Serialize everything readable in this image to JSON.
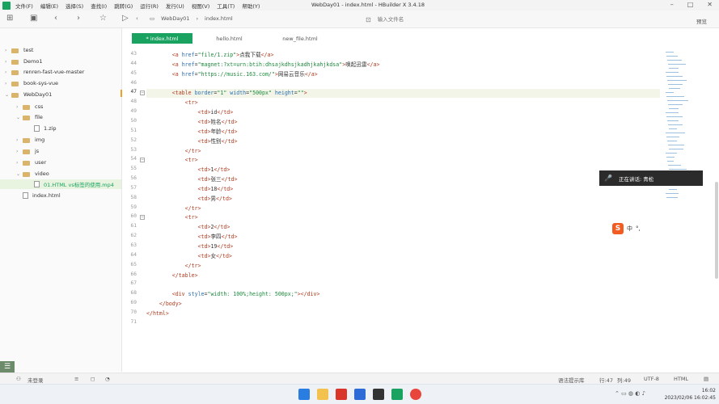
{
  "window": {
    "title": "WebDay01 - index.html - HBuilder X 3.4.18"
  },
  "menu": [
    "文件(F)",
    "编辑(E)",
    "选择(S)",
    "查找(I)",
    "跳转(G)",
    "运行(R)",
    "发行(U)",
    "视图(V)",
    "工具(T)",
    "帮助(Y)"
  ],
  "breadcrumb": [
    "WebDay01",
    "index.html"
  ],
  "search": {
    "placeholder": "输入文件名"
  },
  "preview_label": "预览",
  "sidebar": {
    "items": [
      {
        "label": "test",
        "type": "folder",
        "indent": 0,
        "expanded": false
      },
      {
        "label": "Demo1",
        "type": "folder",
        "indent": 0,
        "expanded": false
      },
      {
        "label": "renren-fast-vue-master",
        "type": "folder",
        "indent": 0,
        "expanded": false
      },
      {
        "label": "book-sys-vue",
        "type": "folder",
        "indent": 0,
        "expanded": false
      },
      {
        "label": "WebDay01",
        "type": "folder",
        "indent": 0,
        "expanded": true
      },
      {
        "label": "css",
        "type": "folder",
        "indent": 1,
        "expanded": false
      },
      {
        "label": "file",
        "type": "folder",
        "indent": 1,
        "expanded": true
      },
      {
        "label": "1.zip",
        "type": "file",
        "indent": 2
      },
      {
        "label": "img",
        "type": "folder",
        "indent": 1,
        "expanded": false
      },
      {
        "label": "js",
        "type": "folder",
        "indent": 1,
        "expanded": false
      },
      {
        "label": "user",
        "type": "folder",
        "indent": 1,
        "expanded": false
      },
      {
        "label": "video",
        "type": "folder",
        "indent": 1,
        "expanded": true
      },
      {
        "label": "01.HTML vs标签的使用.mp4",
        "type": "file",
        "indent": 2,
        "selected": true
      },
      {
        "label": "index.html",
        "type": "file",
        "indent": 1
      }
    ]
  },
  "tabs": [
    {
      "label": "* index.html",
      "active": true
    },
    {
      "label": "hello.html",
      "active": false
    },
    {
      "label": "new_file.html",
      "active": false
    }
  ],
  "code": {
    "current_line": 47,
    "lines": [
      {
        "no": "43",
        "text": "        <a href=\"file/1.zip\">点我下载</a>"
      },
      {
        "no": "44",
        "text": "        <a href=\"magnet:?xt=urn:btih:dhsajkdhsjkadhjkahjkdsa\">唤起迅雷</a>"
      },
      {
        "no": "45",
        "text": "        <a href=\"https://music.163.com/\">网易云音乐</a>"
      },
      {
        "no": "46",
        "text": ""
      },
      {
        "no": "47",
        "text": "        <table border=\"1\" width=\"500px\" height=\"\">",
        "fold": true
      },
      {
        "no": "48",
        "text": "            <tr>"
      },
      {
        "no": "49",
        "text": "                <td>id</td>"
      },
      {
        "no": "50",
        "text": "                <td>姓名</td>"
      },
      {
        "no": "51",
        "text": "                <td>年龄</td>"
      },
      {
        "no": "52",
        "text": "                <td>性别</td>"
      },
      {
        "no": "53",
        "text": "            </tr>"
      },
      {
        "no": "54",
        "text": "            <tr>",
        "fold": true
      },
      {
        "no": "55",
        "text": "                <td>1</td>"
      },
      {
        "no": "56",
        "text": "                <td>张三</td>"
      },
      {
        "no": "57",
        "text": "                <td>18</td>"
      },
      {
        "no": "58",
        "text": "                <td>男</td>"
      },
      {
        "no": "59",
        "text": "            </tr>"
      },
      {
        "no": "60",
        "text": "            <tr>",
        "fold": true
      },
      {
        "no": "61",
        "text": "                <td>2</td>"
      },
      {
        "no": "62",
        "text": "                <td>李四</td>"
      },
      {
        "no": "63",
        "text": "                <td>19</td>"
      },
      {
        "no": "64",
        "text": "                <td>女</td>"
      },
      {
        "no": "65",
        "text": "            </tr>"
      },
      {
        "no": "66",
        "text": "        </table>"
      },
      {
        "no": "67",
        "text": ""
      },
      {
        "no": "68",
        "text": "        <div style=\"width: 100%;height: 500px;\"></div>"
      },
      {
        "no": "69",
        "text": "    </body>"
      },
      {
        "no": "70",
        "text": "</html>"
      },
      {
        "no": "71",
        "text": ""
      }
    ]
  },
  "notification": {
    "text": "正在讲话: 青松"
  },
  "ime": {
    "mode": "中",
    "extra": "°,"
  },
  "statusbar": {
    "login": "未登录",
    "syntax_hint": "语法提示库",
    "line": "行:47",
    "col": "列:49",
    "encoding": "UTF-8",
    "language": "HTML"
  },
  "clock": {
    "time": "16:02",
    "date": "2023/02/06 16:02:45"
  },
  "colors": {
    "accent": "#1aa260",
    "tag": "#b03a1e",
    "attr": "#2b6fb0",
    "string": "#1e8a3e"
  }
}
